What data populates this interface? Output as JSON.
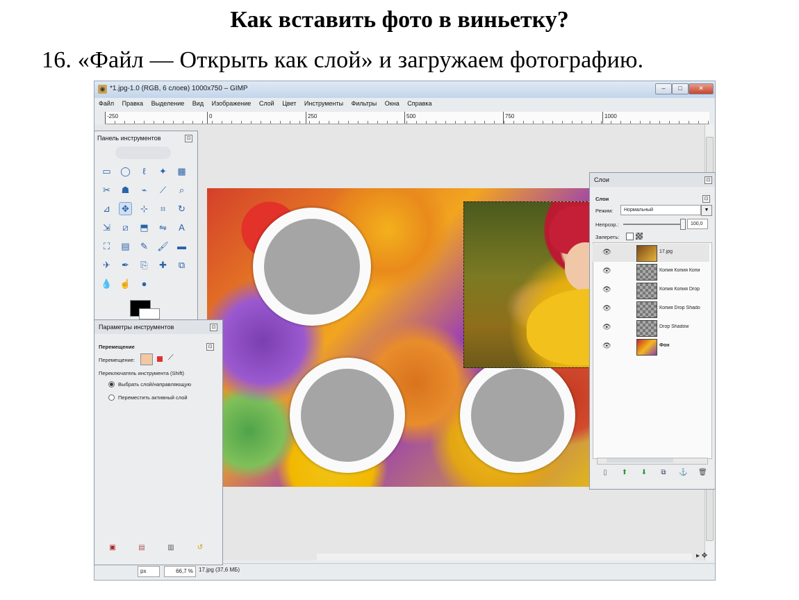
{
  "heading": "Как вставить фото в виньетку?",
  "step": "16. «Файл — Открыть как слой» и загружаем фотографию.",
  "window": {
    "title": "*1.jpg-1.0 (RGB, 6 слоев) 1000x750 – GIMP",
    "app_icon": "gimp-icon",
    "btn_minimize": "–",
    "btn_maximize": "□",
    "btn_close": "✕"
  },
  "menu": [
    "Файл",
    "Правка",
    "Выделение",
    "Вид",
    "Изображение",
    "Слой",
    "Цвет",
    "Инструменты",
    "Фильтры",
    "Окна",
    "Справка"
  ],
  "ruler": {
    "labels": [
      "-250",
      "0",
      "250",
      "500",
      "750",
      "1000"
    ]
  },
  "toolbox": {
    "title": "Панель инструментов",
    "close": "⊡",
    "tools": [
      {
        "name": "rect-select-icon",
        "glyph": "▭"
      },
      {
        "name": "ellipse-select-icon",
        "glyph": "◯"
      },
      {
        "name": "lasso-icon",
        "glyph": "ℓ"
      },
      {
        "name": "fuzzy-select-icon",
        "glyph": "✦"
      },
      {
        "name": "color-select-icon",
        "glyph": "▦"
      },
      {
        "name": "scissors-icon",
        "glyph": "✂"
      },
      {
        "name": "foreground-select-icon",
        "glyph": "☗"
      },
      {
        "name": "paths-icon",
        "glyph": "⌁"
      },
      {
        "name": "color-picker-icon",
        "glyph": "⟋"
      },
      {
        "name": "zoom-icon",
        "glyph": "⌕"
      },
      {
        "name": "measure-icon",
        "glyph": "⊿"
      },
      {
        "name": "move-icon",
        "glyph": "✥"
      },
      {
        "name": "align-icon",
        "glyph": "⊹"
      },
      {
        "name": "crop-icon",
        "glyph": "⌗"
      },
      {
        "name": "rotate-icon",
        "glyph": "↻"
      },
      {
        "name": "scale-icon",
        "glyph": "⇲"
      },
      {
        "name": "shear-icon",
        "glyph": "⧄"
      },
      {
        "name": "perspective-icon",
        "glyph": "⬒"
      },
      {
        "name": "flip-icon",
        "glyph": "⇋"
      },
      {
        "name": "text-icon",
        "glyph": "A"
      },
      {
        "name": "bucket-fill-icon",
        "glyph": "⛶"
      },
      {
        "name": "blend-icon",
        "glyph": "▤"
      },
      {
        "name": "pencil-icon",
        "glyph": "✎"
      },
      {
        "name": "paintbrush-icon",
        "glyph": "🖌"
      },
      {
        "name": "eraser-icon",
        "glyph": "▬"
      },
      {
        "name": "airbrush-icon",
        "glyph": "✈"
      },
      {
        "name": "ink-icon",
        "glyph": "✒"
      },
      {
        "name": "clone-icon",
        "glyph": "⎘"
      },
      {
        "name": "heal-icon",
        "glyph": "✚"
      },
      {
        "name": "perspective-clone-icon",
        "glyph": "⧉"
      },
      {
        "name": "blur-icon",
        "glyph": "💧"
      },
      {
        "name": "smudge-icon",
        "glyph": "☝"
      },
      {
        "name": "dodge-burn-icon",
        "glyph": "●"
      }
    ],
    "fg_color": "#000000",
    "bg_color": "#ffffff"
  },
  "tool_options": {
    "title": "Параметры инструментов",
    "close": "⊡",
    "section": "Перемещение",
    "move_label": "Перемещение:",
    "switch_label": "Переключатель инструмента (Shift)",
    "option_1": "Выбрать слой/направляющую",
    "option_2": "Переместить активный слой",
    "footer_icons": [
      "save-options-icon",
      "restore-options-icon",
      "delete-options-icon",
      "reset-options-icon"
    ]
  },
  "layers": {
    "title": "Слои",
    "close": "⊡",
    "subtitle": "Слои",
    "mode_label": "Режим:",
    "mode_value": "Нормальный",
    "opacity_label": "Непрозр.:",
    "opacity_value": "100,0",
    "lock_label": "Запереть:",
    "items": [
      {
        "name": "17.jpg"
      },
      {
        "name": "Копия Копия Копи"
      },
      {
        "name": "Копия Копия Drop"
      },
      {
        "name": "Копия Drop Shado"
      },
      {
        "name": "Drop Shadow"
      },
      {
        "name": "Фон"
      }
    ]
  },
  "status": {
    "unit": "px",
    "zoom": "66,7 %",
    "file": "17.jpg (37,6 МБ)"
  }
}
